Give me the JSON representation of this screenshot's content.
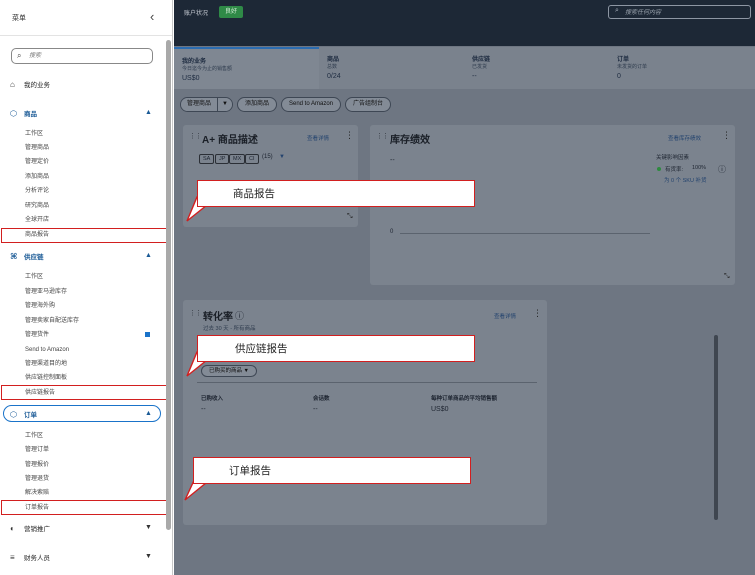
{
  "sidebar": {
    "title": "菜单",
    "collapse_icon": "chevron-left-icon",
    "search_placeholder": "搜索",
    "home": "我的业务",
    "products": {
      "label": "商品",
      "items": [
        "工作区",
        "管理商品",
        "管理定价",
        "添加商品",
        "分析评论",
        "研究商品",
        "全球开店",
        "商品报告"
      ]
    },
    "supply": {
      "label": "供应链",
      "items": [
        "工作区",
        "管理亚马逊库存",
        "管理海外购",
        "管理卖家自配送库存",
        "管理货件",
        "Send to Amazon",
        "管理渠道目的地",
        "供应链控制面板",
        "供应链报告"
      ]
    },
    "orders": {
      "label": "订单",
      "items": [
        "工作区",
        "管理订单",
        "管理报价",
        "管理退货",
        "解决索赔",
        "订单报告"
      ]
    },
    "marketing": "营销推广",
    "finance": "财务人员"
  },
  "topbar": {
    "account_status_label": "账户状况",
    "account_status_value": "良好",
    "search_placeholder": "搜索任何内容"
  },
  "summary": [
    {
      "title": "我的业务",
      "subtitle": "今日迄今为止的销售额",
      "value": "US$0"
    },
    {
      "title": "商品",
      "subtitle": "总数",
      "value": "0/24"
    },
    {
      "title": "供应链",
      "subtitle": "已发货",
      "value": "--"
    },
    {
      "title": "订单",
      "subtitle": "未发货的订单",
      "value": "0"
    }
  ],
  "actions": {
    "manage_products": "管理商品",
    "dropdown": "▼",
    "add_product": "添加商品",
    "send_to_amazon": "Send to Amazon",
    "ad_campaign": "广告组制台"
  },
  "aplus_card": {
    "title": "A+ 商品描述",
    "link": "查看详情",
    "marketplaces": [
      "SA",
      "JP",
      "MX",
      "CI"
    ],
    "count": "(15)",
    "dropdown": "▼"
  },
  "inventory_card": {
    "title": "库存绩效",
    "link": "查看库存绩效",
    "value": "--",
    "axis_zero": "0",
    "key_factors_label": "关键影响因素",
    "instock_label": "有货率:",
    "instock_value": "100%",
    "instock_note": "为 0 个 SKU 补货"
  },
  "conversion_card": {
    "title": "转化率",
    "info_icon": "info-icon",
    "link": "查看详情",
    "subtitle": "过去 30 天 - 所有商品",
    "filter": "已购买的商品",
    "metrics": [
      {
        "label": "已购收入",
        "value": "--"
      },
      {
        "label": "会话数",
        "value": "--"
      },
      {
        "label": "每种订单商品的平均销售额",
        "value": "US$0"
      }
    ]
  },
  "callouts": {
    "products_report": "商品报告",
    "supply_report": "供应链报告",
    "orders_report": "订单报告"
  },
  "colors": {
    "highlight": "#d21f1f",
    "accent": "#1a5a96",
    "status_good": "#2f8a47",
    "topbar": "#1d2836"
  }
}
